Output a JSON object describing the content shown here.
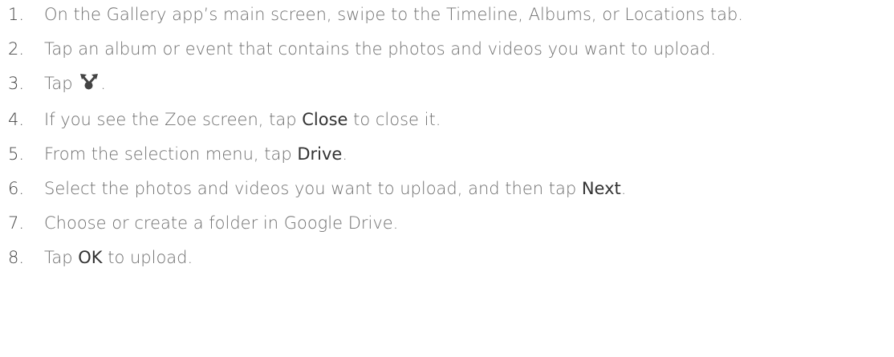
{
  "steps": [
    {
      "num": "1.",
      "text": "On the Gallery app’s main screen, swipe to the Timeline, Albums, or Locations tab."
    },
    {
      "num": "2.",
      "text": "Tap an album or event that contains the photos and videos you want to upload."
    },
    {
      "num": "3.",
      "pre": "Tap ",
      "icon": "share-icon",
      "post": "."
    },
    {
      "num": "4.",
      "pre": "If you see the Zoe screen, tap ",
      "bold": "Close",
      "post": " to close it."
    },
    {
      "num": "5.",
      "pre": "From the selection menu, tap ",
      "bold": "Drive",
      "post": "."
    },
    {
      "num": "6.",
      "pre": "Select the photos and videos you want to upload, and then tap ",
      "bold": "Next",
      "post": "."
    },
    {
      "num": "7.",
      "text": "Choose or create a folder in Google Drive."
    },
    {
      "num": "8.",
      "pre": "Tap ",
      "bold": "OK",
      "post": " to upload."
    }
  ]
}
